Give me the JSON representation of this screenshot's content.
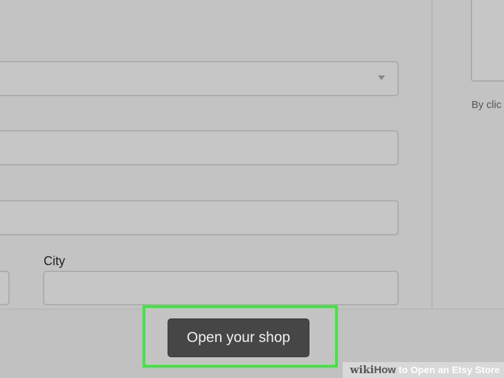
{
  "form": {
    "city_label": "City",
    "select_icon": "chevron-down-icon"
  },
  "sidebar": {
    "terms_text": "By clic"
  },
  "footer": {
    "open_shop_label": "Open your shop"
  },
  "watermark": {
    "wiki": "wiki",
    "how": "How",
    "title": " to Open an Etsy Store"
  },
  "colors": {
    "background": "#c1c1c1",
    "button": "#464646",
    "highlight": "#3ee63e"
  }
}
